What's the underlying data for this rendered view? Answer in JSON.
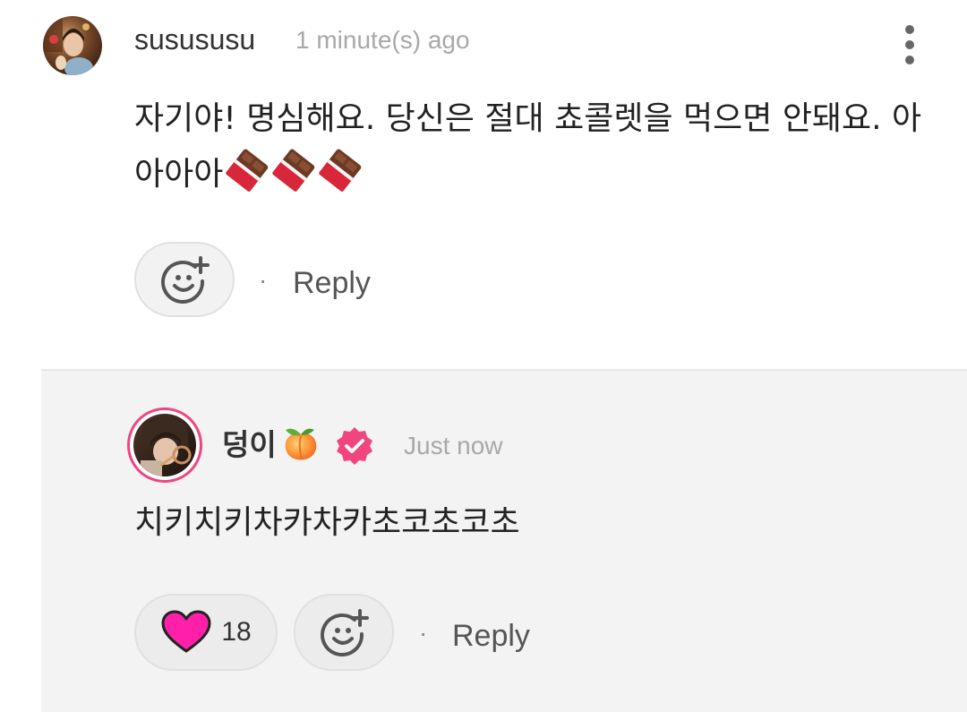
{
  "comment": {
    "username": "sususus­u",
    "time": "1 minute(s) ago",
    "text": "자기야! 명심해요. 당신은 절대 쵸콜렛을 먹으면 안돼요. 아아아아",
    "reply_label": "Reply",
    "separator": "·",
    "more_icon": "more-vertical-icon",
    "react_icon": "add-reaction-icon",
    "emoji_icon": "chocolate-bar-icon"
  },
  "reply": {
    "username": "덩이",
    "time": "Just now",
    "text": "치키치키차카차카초코초코초",
    "like_count": "18",
    "reply_label": "Reply",
    "separator": "·",
    "name_emoji_icon": "peach-icon",
    "verified_icon": "verified-badge-icon",
    "like_icon": "heart-icon",
    "react_icon": "add-reaction-icon"
  },
  "colors": {
    "verified_badge": "#f0457f",
    "heart_fill": "#ff1fa8",
    "avatar_ring": "#f0457f",
    "reply_bg": "#f3f3f3"
  }
}
